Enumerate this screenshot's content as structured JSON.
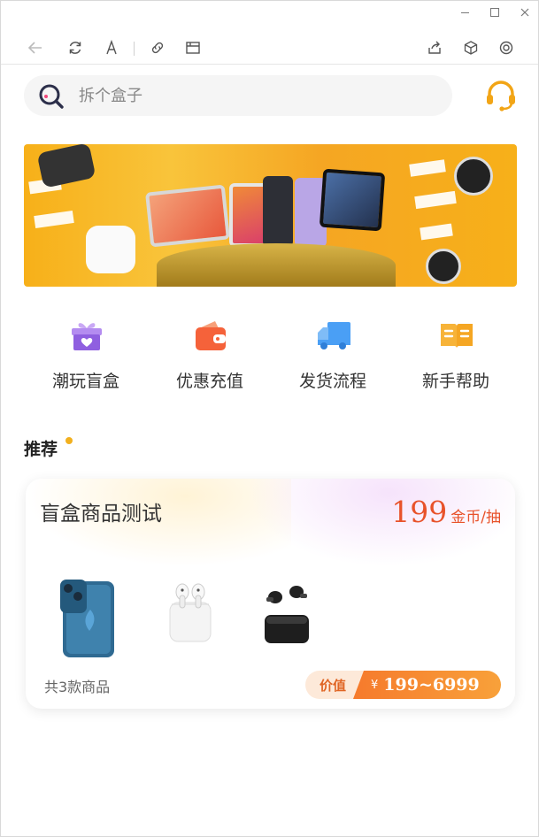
{
  "search": {
    "placeholder": "拆个盒子"
  },
  "categories": [
    {
      "label": "潮玩盲盒",
      "icon": "gift-box-icon",
      "color": "#9b6be0"
    },
    {
      "label": "优惠充值",
      "icon": "wallet-icon",
      "color": "#f5623a"
    },
    {
      "label": "发货流程",
      "icon": "delivery-truck-icon",
      "color": "#4a9ff5"
    },
    {
      "label": "新手帮助",
      "icon": "open-book-icon",
      "color": "#f5a623"
    }
  ],
  "recommend": {
    "title": "推荐",
    "card": {
      "title": "盲盒商品测试",
      "price": "199",
      "price_unit": "金币/抽",
      "count_text": "共3款商品",
      "value_label": "价值",
      "currency": "¥",
      "value_range": "199~6999",
      "products": [
        "phone-image",
        "earbuds-case-image",
        "wireless-earbuds-image"
      ]
    }
  },
  "colors": {
    "accent": "#e8522a",
    "brand_yellow": "#f2b01e"
  }
}
